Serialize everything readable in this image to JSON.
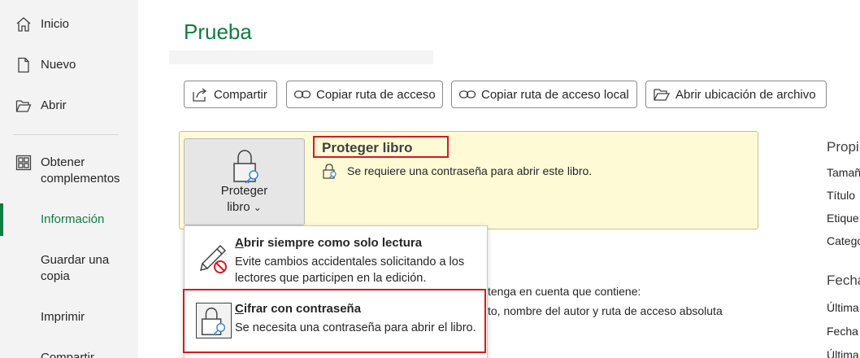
{
  "sidebar": {
    "items": [
      {
        "label": "Inicio",
        "icon": "home-icon"
      },
      {
        "label": "Nuevo",
        "icon": "new-document-icon"
      },
      {
        "label": "Abrir",
        "icon": "folder-open-icon"
      },
      {
        "label_line1": "Obtener",
        "label_line2": "complementos",
        "icon": "add-ins-grid-icon"
      },
      {
        "label": "Información",
        "active": true
      },
      {
        "label_line1": "Guardar una",
        "label_line2": "copia"
      },
      {
        "label": "Imprimir"
      },
      {
        "label": "Compartir"
      }
    ]
  },
  "main": {
    "title": "Prueba",
    "actions": [
      {
        "label": "Compartir",
        "icon": "share-icon"
      },
      {
        "label": "Copiar ruta de acceso",
        "icon": "link-icon"
      },
      {
        "label": "Copiar ruta de acceso local",
        "icon": "link-icon"
      },
      {
        "label": "Abrir ubicación de archivo",
        "icon": "folder-open-icon"
      }
    ],
    "protect": {
      "button_line1": "Proteger",
      "button_line2": "libro",
      "chevron": "⌄",
      "heading": "Proteger libro",
      "description": "Se requiere una contraseña para abrir este libro."
    },
    "inspect_partial": {
      "line1": "tenga en cuenta que contiene:",
      "line2": "to, nombre del autor y ruta de acceso absoluta"
    },
    "properties": {
      "heading": "Propi",
      "rows": [
        "Tamañ",
        "Título",
        "Etique",
        "Catego"
      ],
      "dates_heading": "Fecha",
      "dates_rows": [
        "Última",
        "Fecha",
        "Última"
      ]
    }
  },
  "menu": {
    "items": [
      {
        "title_underline": "A",
        "title_rest": "brir siempre como solo lectura",
        "desc": "Evite cambios accidentales solicitando a los lectores que participen en la edición.",
        "icon": "pencil-prohibited-icon"
      },
      {
        "title_underline": "C",
        "title_rest": "ifrar con contraseña",
        "desc": "Se necesita una contraseña para abrir el libro.",
        "icon": "lock-key-icon"
      }
    ]
  },
  "colors": {
    "accent": "#107c41",
    "panel_bg": "#fdfad5",
    "highlight_red": "#d71920",
    "sidebar_bg": "#f3f3f3"
  }
}
